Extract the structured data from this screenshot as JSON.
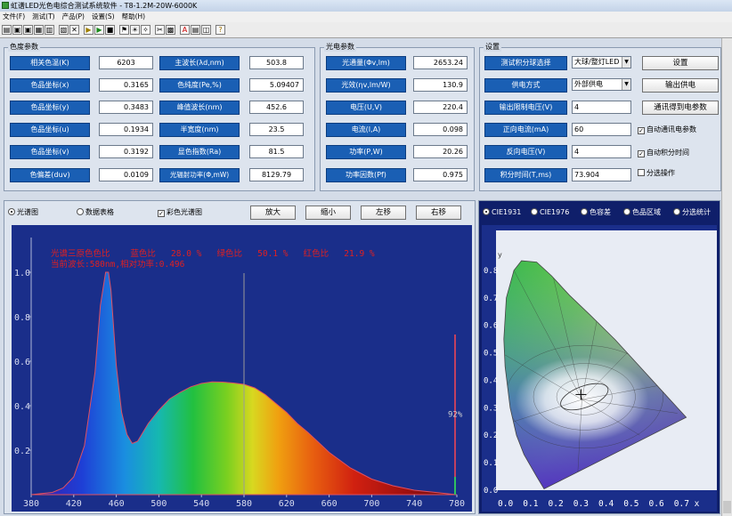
{
  "window": {
    "title": "虹谱LED光色电综合测试系统软件 - T8-1.2M-20W-6000K"
  },
  "menu": [
    "文件(F)",
    "测试(T)",
    "产品(P)",
    "设置(S)",
    "帮助(H)"
  ],
  "color_panel": {
    "title": "色度参数",
    "rows": [
      {
        "label": "相关色温(K)",
        "value": "6203",
        "label2": "主波长(λd,nm)",
        "value2": "503.8"
      },
      {
        "label": "色品坐标(x)",
        "value": "0.3165",
        "label2": "色纯度(Pe,%)",
        "value2": "5.09407"
      },
      {
        "label": "色品坐标(y)",
        "value": "0.3483",
        "label2": "峰值波长(nm)",
        "value2": "452.6"
      },
      {
        "label": "色品坐标(u)",
        "value": "0.1934",
        "label2": "半宽度(nm)",
        "value2": "23.5"
      },
      {
        "label": "色品坐标(v)",
        "value": "0.3192",
        "label2": "显色指数(Ra)",
        "value2": "81.5"
      },
      {
        "label": "色偏差(duv)",
        "value": "0.0109",
        "label2": "光辐射功率(Φ,mW)",
        "value2": "8129.79"
      }
    ]
  },
  "elec_panel": {
    "title": "光电参数",
    "rows": [
      {
        "label": "光通量(Φv,lm)",
        "value": "2653.24"
      },
      {
        "label": "光效(ηv,lm/W)",
        "value": "130.9"
      },
      {
        "label": "电压(U,V)",
        "value": "220.4"
      },
      {
        "label": "电流(I,A)",
        "value": "0.098"
      },
      {
        "label": "功率(P,W)",
        "value": "20.26"
      },
      {
        "label": "功率因数(Pf)",
        "value": "0.975"
      }
    ]
  },
  "settings_panel": {
    "title": "设置",
    "sphere_label": "测试积分球选择",
    "sphere_value": "大球/整灯LED",
    "power_label": "供电方式",
    "power_value": "外部供电",
    "limit_label": "输出限制电压(V)",
    "limit_value": "4",
    "fwd_label": "正向电流(mA)",
    "fwd_value": "60",
    "rev_label": "反向电压(V)",
    "rev_value": "4",
    "integ_label": "积分时间(T,ms)",
    "integ_value": "73.904",
    "btn_settings": "设置",
    "btn_output": "输出供电",
    "btn_comm": "通讯得到电参数",
    "chk_auto_comm": "自动通讯电参数",
    "chk_auto_integ": "自动积分时间",
    "chk_sort": "分选操作"
  },
  "spectrum_toolbar": {
    "opt_spectrum": "光谱图",
    "opt_table": "数据表格",
    "opt_color": "彩色光谱图",
    "btn_zoom_in": "放大",
    "btn_zoom_out": "缩小",
    "btn_left": "左移",
    "btn_right": "右移"
  },
  "cie_toolbar": {
    "opt_cie1931": "CIE1931",
    "opt_cie1976": "CIE1976",
    "opt_tolerance": "色容差",
    "opt_region": "色品区域",
    "opt_sort": "分选统计"
  },
  "chart_data": {
    "type": "area",
    "annotation_line1": "光谱三原色色比    蓝色比   28.0 %   绿色比   50.1 %   红色比   21.9 %",
    "annotation_line2": "当前波长:580nm,相对功率:0.496",
    "side_label": "92%",
    "x_ticks": [
      "380",
      "420",
      "460",
      "500",
      "540",
      "580",
      "620",
      "660",
      "700",
      "740",
      "780"
    ],
    "y_ticks": [
      "1.0",
      "0.8",
      "0.6",
      "0.4",
      "0.2"
    ],
    "xlim": [
      380,
      780
    ],
    "ylim": [
      0,
      1.0
    ],
    "cursor_wavelength": 580,
    "x": [
      380,
      400,
      410,
      420,
      430,
      440,
      445,
      450,
      452.6,
      455,
      460,
      465,
      470,
      475,
      480,
      490,
      500,
      510,
      520,
      530,
      540,
      550,
      560,
      570,
      580,
      590,
      600,
      610,
      620,
      630,
      640,
      650,
      660,
      680,
      700,
      720,
      740,
      760,
      780
    ],
    "values": [
      0.0,
      0.01,
      0.03,
      0.08,
      0.22,
      0.55,
      0.85,
      1.0,
      1.0,
      0.92,
      0.58,
      0.37,
      0.27,
      0.23,
      0.24,
      0.32,
      0.38,
      0.43,
      0.46,
      0.485,
      0.5,
      0.507,
      0.506,
      0.502,
      0.496,
      0.48,
      0.45,
      0.41,
      0.37,
      0.32,
      0.28,
      0.235,
      0.19,
      0.12,
      0.07,
      0.04,
      0.02,
      0.01,
      0.0
    ]
  },
  "cie_chart": {
    "y_ticks": [
      "0.8",
      "0.7",
      "0.6",
      "0.5",
      "0.4",
      "0.3",
      "0.2",
      "0.1",
      "0.0"
    ],
    "x_ticks": [
      "0.0",
      "0.1",
      "0.2",
      "0.3",
      "0.4",
      "0.5",
      "0.6",
      "0.7 x"
    ],
    "y_axis_label": "y",
    "point_x": 0.3165,
    "point_y": 0.3483
  }
}
